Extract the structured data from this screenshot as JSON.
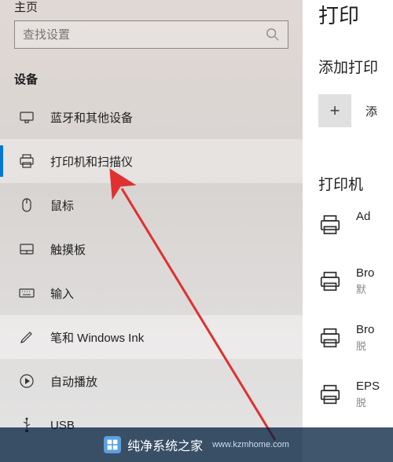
{
  "sidebar": {
    "home_label": "主页",
    "search_placeholder": "查找设置",
    "section_title": "设备",
    "items": [
      {
        "label": "蓝牙和其他设备"
      },
      {
        "label": "打印机和扫描仪"
      },
      {
        "label": "鼠标"
      },
      {
        "label": "触摸板"
      },
      {
        "label": "输入"
      },
      {
        "label": "笔和 Windows Ink"
      },
      {
        "label": "自动播放"
      },
      {
        "label": "USB"
      }
    ]
  },
  "main": {
    "title_truncated": "打印",
    "subtitle": "添加打印",
    "add_label": "添",
    "list_head": "打印机",
    "printers": [
      {
        "name": "Ad",
        "status": ""
      },
      {
        "name": "Bro",
        "status": "默"
      },
      {
        "name": "Bro",
        "status": "脱"
      },
      {
        "name": "EPS",
        "status": "脱"
      }
    ]
  },
  "watermark": {
    "text": "纯净系统之家",
    "url": "www.kzmhome.com"
  }
}
